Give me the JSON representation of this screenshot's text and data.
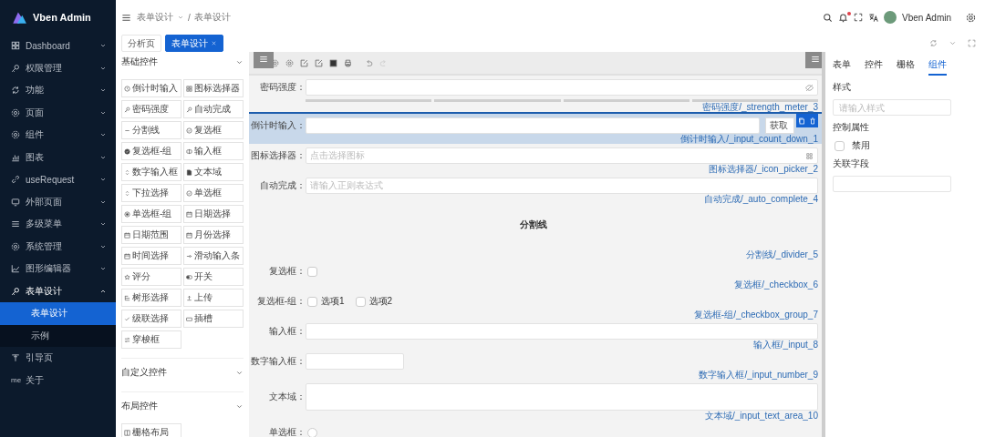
{
  "sidebar": {
    "logo": "Vben Admin",
    "items": [
      {
        "label": "Dashboard",
        "kind": "submenu",
        "expanded": false
      },
      {
        "label": "权限管理",
        "kind": "submenu",
        "expanded": false
      },
      {
        "label": "功能",
        "kind": "submenu",
        "expanded": false
      },
      {
        "label": "页面",
        "kind": "submenu",
        "expanded": false
      },
      {
        "label": "组件",
        "kind": "submenu",
        "expanded": false
      },
      {
        "label": "图表",
        "kind": "submenu",
        "expanded": false
      },
      {
        "label": "useRequest",
        "kind": "submenu",
        "expanded": false
      },
      {
        "label": "外部页面",
        "kind": "submenu",
        "expanded": false
      },
      {
        "label": "多级菜单",
        "kind": "submenu",
        "expanded": false
      },
      {
        "label": "系统管理",
        "kind": "submenu",
        "expanded": false
      },
      {
        "label": "图形编辑器",
        "kind": "submenu",
        "expanded": false
      },
      {
        "label": "表单设计",
        "kind": "submenu",
        "expanded": true,
        "children": [
          {
            "label": "表单设计",
            "selected": true
          },
          {
            "label": "示例",
            "selected": false
          }
        ]
      },
      {
        "label": "引导页",
        "kind": "link"
      },
      {
        "label": "关于",
        "kind": "link",
        "icon_text": "me"
      }
    ]
  },
  "header": {
    "breadcrumb": [
      {
        "label": "表单设计",
        "dropdown": true
      },
      {
        "label": "表单设计",
        "dropdown": false
      }
    ],
    "separator": "/",
    "user": "Vben Admin",
    "notification": true
  },
  "tabs": [
    {
      "label": "分析页",
      "selected": false
    },
    {
      "label": "表单设计",
      "selected": true
    }
  ],
  "palette": {
    "sections": [
      {
        "title": "基础控件",
        "items": [
          "倒计时输入",
          "图标选择器",
          "密码强度",
          "自动完成",
          "分割线",
          "复选框",
          "复选框-组",
          "输入框",
          "数字输入框",
          "文本域",
          "下拉选择",
          "单选框",
          "单选框-组",
          "日期选择",
          "日期范围",
          "月份选择",
          "时间选择",
          "滑动输入条",
          "评分",
          "开关",
          "树形选择",
          "上传",
          "级联选择",
          "插槽",
          "穿梭框"
        ]
      },
      {
        "title": "自定义控件"
      },
      {
        "title": "布局控件",
        "items": [
          "栅格布局"
        ]
      }
    ]
  },
  "canvas": {
    "fields": [
      {
        "kind": "strength",
        "label": "密码强度：",
        "caption": "密码强度/_strength_meter_3",
        "selected": false
      },
      {
        "kind": "countdown",
        "label": "倒计时输入：",
        "button": "获取",
        "caption": "倒计时输入/_input_count_down_1",
        "selected": true
      },
      {
        "kind": "icon_picker",
        "label": "图标选择器：",
        "placeholder": "点击选择图标",
        "caption": "图标选择器/_icon_picker_2",
        "selected": false
      },
      {
        "kind": "input",
        "label": "自动完成：",
        "placeholder": "请输入正则表达式",
        "caption": "自动完成/_auto_complete_4",
        "selected": false
      },
      {
        "kind": "divider",
        "text": "分割线",
        "caption": "分割线/_divider_5",
        "selected": false
      },
      {
        "kind": "checkbox",
        "label": "复选框：",
        "checked": false,
        "caption": "复选框/_checkbox_6",
        "selected": false
      },
      {
        "kind": "checkbox_group",
        "label": "复选框-组：",
        "options": [
          {
            "label": "选项1",
            "checked": false
          },
          {
            "label": "选项2",
            "checked": false
          }
        ],
        "caption": "复选框-组/_checkbox_group_7",
        "selected": false
      },
      {
        "kind": "input",
        "label": "输入框：",
        "caption": "输入框/_input_8",
        "selected": false
      },
      {
        "kind": "number",
        "label": "数字输入框：",
        "caption": "数字输入框/_input_number_9",
        "selected": false
      },
      {
        "kind": "textarea",
        "label": "文本域：",
        "caption": "文本域/_input_text_area_10",
        "selected": false
      },
      {
        "kind": "radio",
        "label": "单选框：",
        "checked": false,
        "selected": false
      }
    ]
  },
  "properties": {
    "tabs": [
      {
        "label": "表单",
        "selected": false
      },
      {
        "label": "控件",
        "selected": false
      },
      {
        "label": "栅格",
        "selected": false
      },
      {
        "label": "组件",
        "selected": true
      }
    ],
    "style_label": "样式",
    "style_placeholder": "请输入样式",
    "control_label": "控制属性",
    "disabled": {
      "label": "禁用",
      "checked": false
    },
    "link_label": "关联字段"
  }
}
